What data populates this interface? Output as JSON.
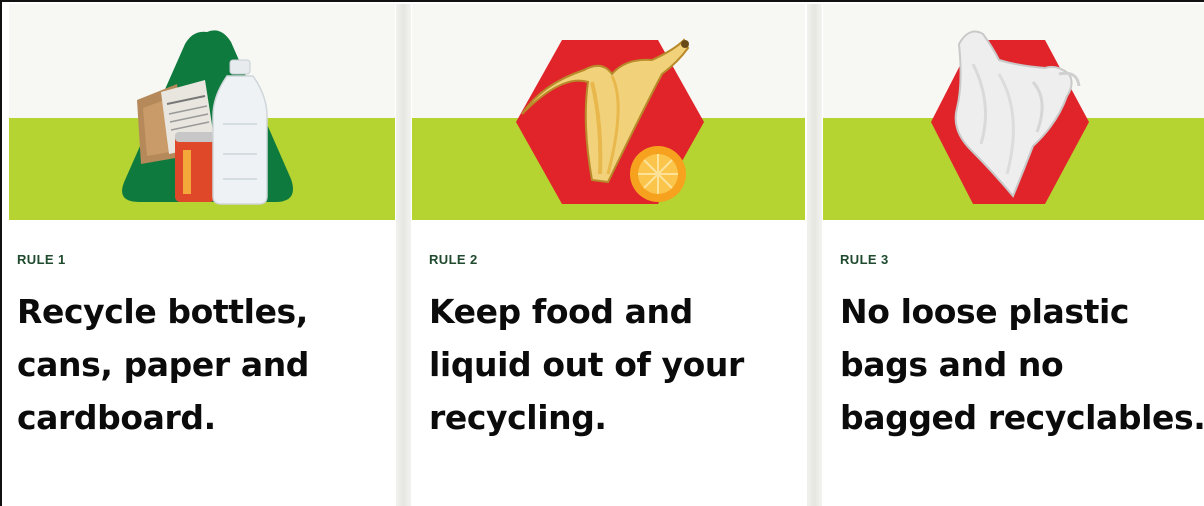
{
  "rules": [
    {
      "label": "RULE 1",
      "text": "Recycle bottles, cans, paper and cardboard.",
      "illustration": "recyclables-triangle-icon",
      "shape_color": "#0f7a3e"
    },
    {
      "label": "RULE 2",
      "text": "Keep food and liquid out of your recycling.",
      "illustration": "food-waste-hexagon-icon",
      "shape_color": "#e0242a"
    },
    {
      "label": "RULE 3",
      "text": "No loose plastic bags and no bagged recyclables.",
      "illustration": "plastic-bag-hexagon-icon",
      "shape_color": "#e0242a"
    }
  ],
  "colors": {
    "banner_green": "#b5d331",
    "banner_light": "#f7f7f3",
    "label_color": "#1f4a2e",
    "text_color": "#0b0b0b"
  }
}
